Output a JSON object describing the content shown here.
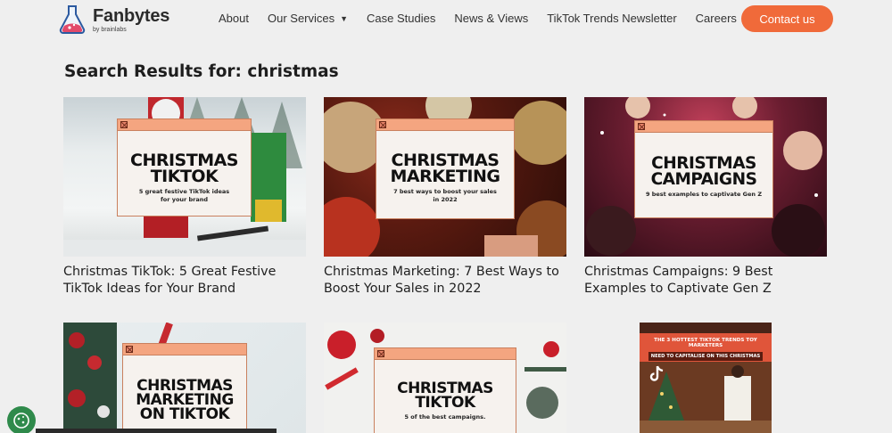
{
  "header": {
    "brand": "Fanbytes",
    "brand_sub": "by brainlabs",
    "nav": {
      "about": "About",
      "services": "Our Services",
      "case_studies": "Case Studies",
      "news": "News & Views",
      "newsletter": "TikTok Trends Newsletter",
      "careers": "Careers"
    },
    "contact_label": "Contact us"
  },
  "search": {
    "title": "Search Results for: christmas"
  },
  "results": [
    {
      "thumb_heading_1": "CHRISTMAS",
      "thumb_heading_2": "TIKTOK",
      "thumb_desc_1": "5 great festive TikTok ideas",
      "thumb_desc_2": "for your brand",
      "title": "Christmas TikTok: 5 Great Festive TikTok Ideas for Your Brand"
    },
    {
      "thumb_heading_1": "CHRISTMAS",
      "thumb_heading_2": "MARKETING",
      "thumb_desc_1": "7 best ways to boost your sales",
      "thumb_desc_2": "in 2022",
      "title": "Christmas Marketing: 7 Best Ways to Boost Your Sales in 2022"
    },
    {
      "thumb_heading_1": "CHRISTMAS",
      "thumb_heading_2": "CAMPAIGNS",
      "thumb_desc_1": "9 best examples to captivate Gen Z",
      "title": "Christmas Campaigns: 9 Best Examples to Captivate Gen Z"
    },
    {
      "thumb_heading_1": "CHRISTMAS",
      "thumb_heading_2": "MARKETING",
      "thumb_heading_3": "ON TIKTOK"
    },
    {
      "thumb_heading_1": "CHRISTMAS",
      "thumb_heading_2": "TIKTOK",
      "thumb_desc_1": "5 of the best campaigns."
    },
    {
      "poster_line_1": "THE 3 HOTTEST TIKTOK TRENDS TOY MARKETERS",
      "poster_line_2": "NEED TO CAPITALISE ON THIS CHRISTMAS"
    }
  ],
  "colors": {
    "accent": "#f06a3a",
    "window_bar": "#f4a580",
    "background": "#efefef"
  },
  "icons": {
    "logo": "flask-icon",
    "services_dropdown": "chevron-down-icon",
    "window_close": "close-box-icon",
    "cookie": "cookie-icon",
    "tiktok": "tiktok-icon"
  }
}
